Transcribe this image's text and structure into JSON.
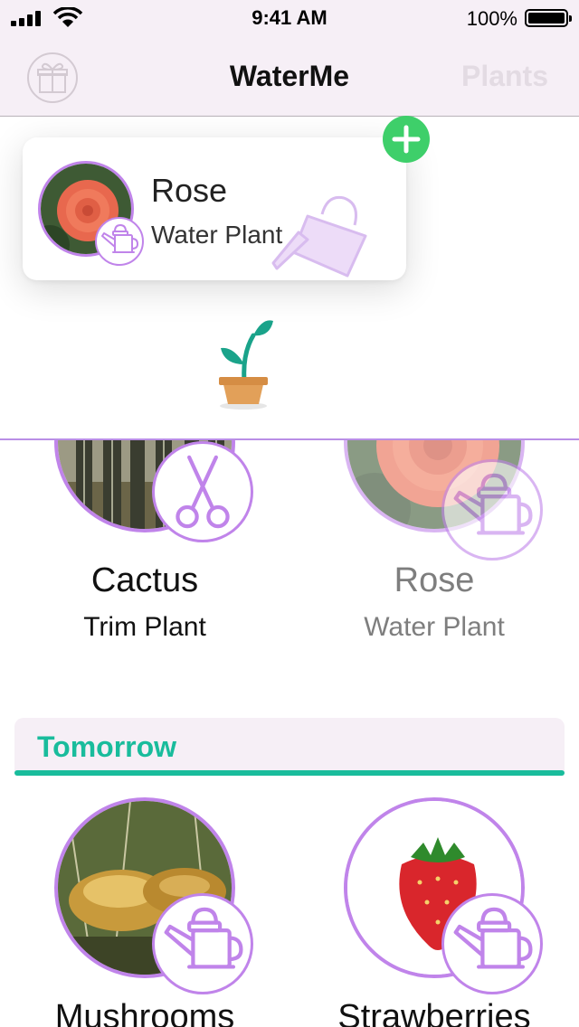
{
  "status_bar": {
    "time": "9:41 AM",
    "battery": "100%"
  },
  "nav": {
    "title": "WaterMe",
    "right_button": "Plants",
    "left_icon": "gift-icon"
  },
  "reminder_card": {
    "name": "Rose",
    "action": "Water Plant",
    "badge_icon": "watering-can-icon"
  },
  "drag_preview_icon": "watering-can-icon",
  "add_icon": "plus-icon",
  "empty_state_icon": "sprout-pot-icon",
  "today_plants": [
    {
      "name": "Cactus",
      "action": "Trim Plant",
      "badge_icon": "scissors-icon"
    },
    {
      "name": "Rose",
      "action": "Water Plant",
      "badge_icon": "watering-can-icon"
    }
  ],
  "sections": [
    {
      "title": "Tomorrow",
      "plants": [
        {
          "name": "Mushrooms",
          "badge_icon": "watering-can-icon"
        },
        {
          "name": "Strawberries",
          "badge_icon": "watering-can-icon"
        }
      ]
    }
  ],
  "colors": {
    "accent_purple": "#c084ea",
    "section_teal": "#19bc9c",
    "add_green": "#3ecf6a",
    "nav_bg": "#f6eff6"
  }
}
